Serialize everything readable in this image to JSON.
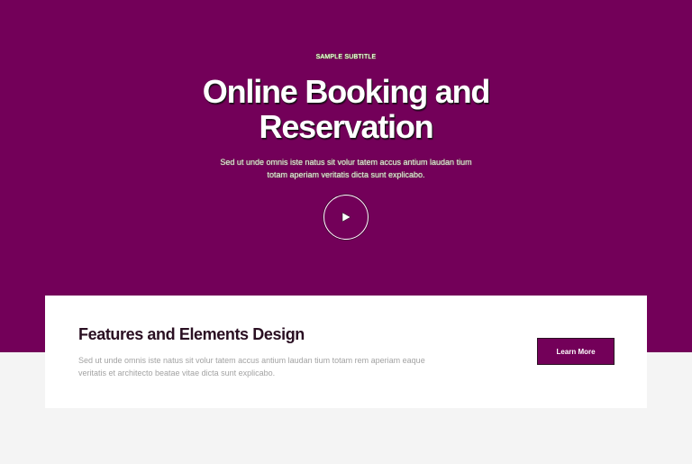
{
  "hero": {
    "subtitle": "SAMPLE SUBTITLE",
    "title": "Online Booking and Reservation",
    "description": "Sed ut unde omnis iste natus sit volur tatem accus antium laudan tium totam aperiam veritatis dicta sunt explicabo.",
    "play_icon": "play-icon",
    "background_color": "#730059"
  },
  "feature_card": {
    "title": "Features and Elements Design",
    "description": "Sed ut unde omnis iste natus sit volur tatem accus antium laudan tium totam rem aperiam eaque veritatis et architecto beatae vitae dicta sunt explicabo.",
    "button_label": "Learn More",
    "button_color": "#730059"
  }
}
